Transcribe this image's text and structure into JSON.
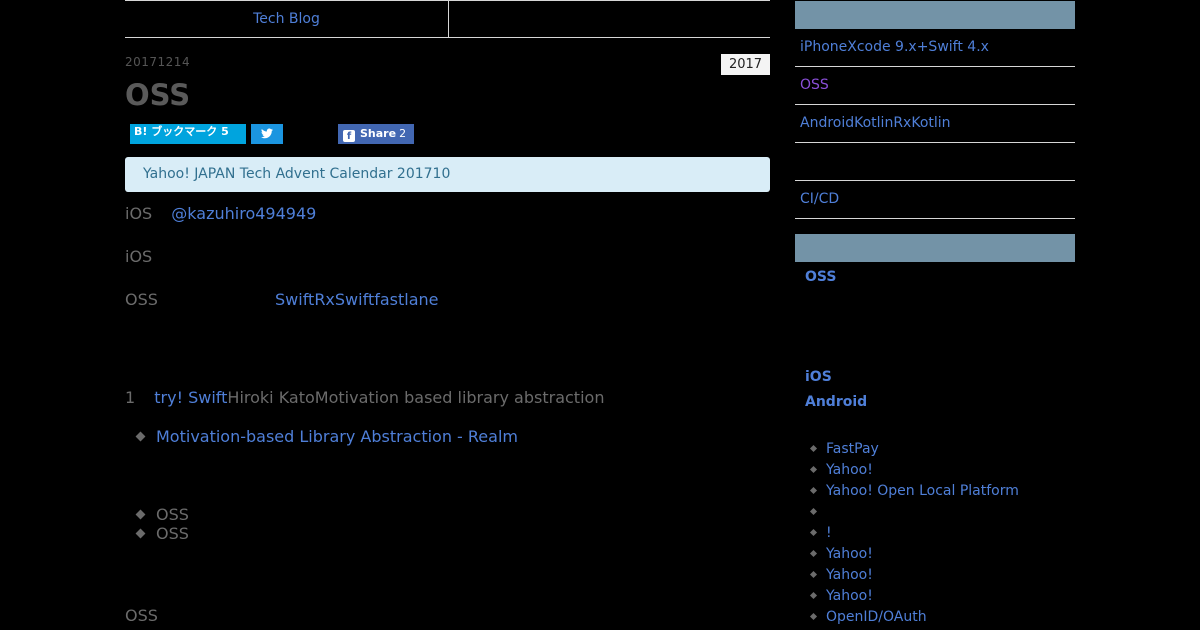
{
  "header": {
    "nav_left": "Tech Blog",
    "nav_right": ""
  },
  "post": {
    "date": "20171214",
    "year_badge": "2017",
    "title": "OSS",
    "share": {
      "hatena_label": "B! ブックマーク",
      "hatena_count": "5",
      "twitter_icon": "twitter-bird-icon",
      "facebook_label": "Share",
      "facebook_count": "2"
    },
    "notice": "Yahoo! JAPAN Tech Advent Calendar 201710",
    "p1_prefix": "iOS",
    "p1_link": "@kazuhiro494949",
    "p2": "iOS",
    "p3_prefix": "OSS",
    "p3_link": "SwiftRxSwiftfastlane",
    "p4_number": "1",
    "p4_link": "try! Swift",
    "p4_rest": "Hiroki KatoMotivation based library abstraction",
    "list1": [
      "Motivation-based Library Abstraction - Realm"
    ],
    "list2": [
      "OSS",
      "OSS"
    ],
    "p5": "OSS"
  },
  "sidebar": {
    "recent_items": [
      "iPhoneXcode 9.x+Swift 4.x",
      "OSS",
      "AndroidKotlinRxKotlin",
      "",
      "CI/CD"
    ],
    "current_entry": "OSS",
    "tags": [
      "iOS",
      "Android"
    ],
    "links": [
      "FastPay",
      "Yahoo!",
      "Yahoo! Open Local Platform",
      "",
      "!",
      "Yahoo!",
      "Yahoo!",
      "Yahoo!",
      "OpenID/OAuth"
    ]
  },
  "colors": {
    "background": "#000000",
    "link": "#4f7fd8",
    "visited_link": "#8a4fd8",
    "sidebar_header": "#7393a7",
    "notice_bg": "#d9edf7",
    "hatena": "#00a4de",
    "twitter": "#1b95e0",
    "facebook": "#4267b2"
  }
}
